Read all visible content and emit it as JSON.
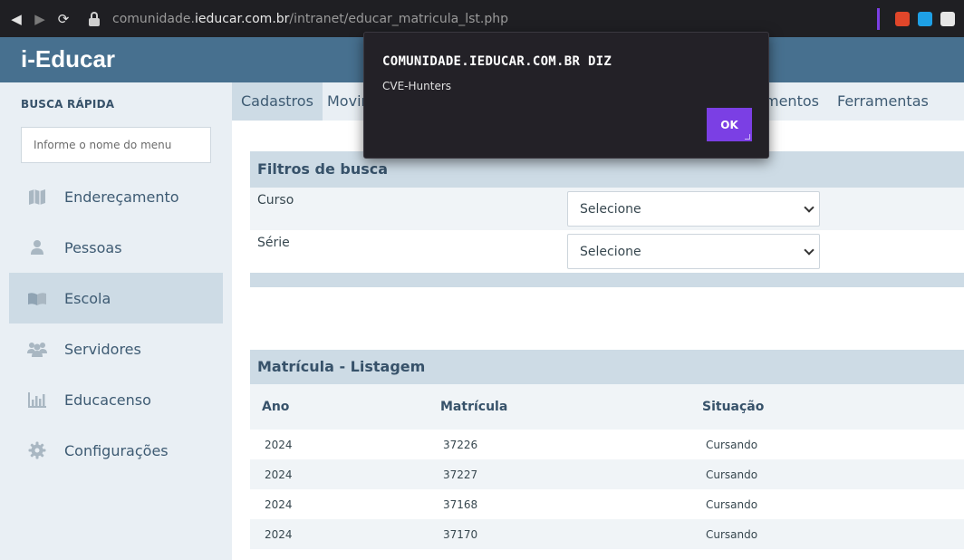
{
  "browser": {
    "url_prefix": "comunidade.",
    "url_domain": "ieducar.com.br",
    "url_path": "/intranet/educar_matricula_lst.php",
    "accent": "#7b3fe4"
  },
  "app": {
    "brand": "i-Educar",
    "header_color": "#47708f"
  },
  "sidebar": {
    "title": "BUSCA RÁPIDA",
    "search_placeholder": "Informe o nome do menu",
    "items": [
      {
        "label": "Endereçamento",
        "icon": "map-icon"
      },
      {
        "label": "Pessoas",
        "icon": "person-icon"
      },
      {
        "label": "Escola",
        "icon": "book-icon",
        "active": true
      },
      {
        "label": "Servidores",
        "icon": "group-icon"
      },
      {
        "label": "Educacenso",
        "icon": "bar-chart-icon"
      },
      {
        "label": "Configurações",
        "icon": "gear-icon"
      }
    ]
  },
  "top_menu": {
    "tabs": [
      {
        "label": "Cadastros",
        "active": true
      },
      {
        "label": "Movim"
      },
      {
        "label": "mentos"
      },
      {
        "label": "Ferramentas"
      }
    ]
  },
  "filters": {
    "title": "Filtros de busca",
    "fields": [
      {
        "label": "Curso",
        "value": "Selecione"
      },
      {
        "label": "Série",
        "value": "Selecione"
      }
    ]
  },
  "listing": {
    "title": "Matrícula - Listagem",
    "columns": [
      "Ano",
      "Matrícula",
      "Situação"
    ],
    "rows": [
      [
        "2024",
        "37226",
        "Cursando"
      ],
      [
        "2024",
        "37227",
        "Cursando"
      ],
      [
        "2024",
        "37168",
        "Cursando"
      ],
      [
        "2024",
        "37170",
        "Cursando"
      ]
    ]
  },
  "dialog": {
    "title": "COMUNIDADE.IEDUCAR.COM.BR DIZ",
    "message": "CVE-Hunters",
    "ok_label": "OK"
  }
}
